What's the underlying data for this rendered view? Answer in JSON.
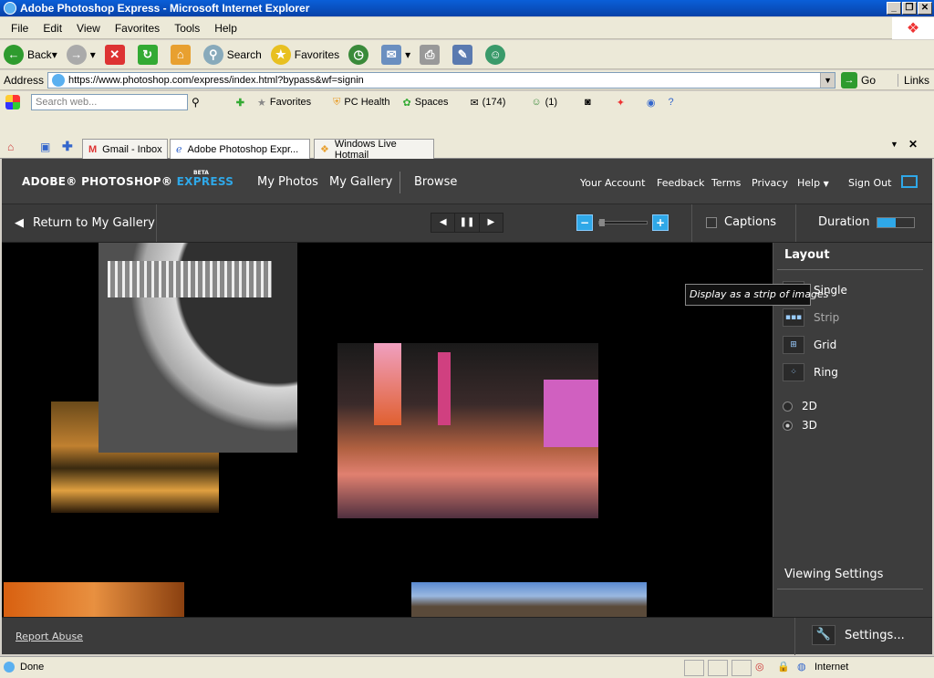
{
  "window": {
    "title": "Adobe Photoshop Express - Microsoft Internet Explorer"
  },
  "menu": [
    "File",
    "Edit",
    "View",
    "Favorites",
    "Tools",
    "Help"
  ],
  "toolbar": {
    "back": "Back",
    "search": "Search",
    "favorites": "Favorites"
  },
  "address": {
    "label": "Address",
    "url": "https://www.photoshop.com/express/index.html?bypass&wf=signin",
    "go": "Go",
    "links": "Links"
  },
  "searchbar": {
    "placeholder": "Search web...",
    "favorites": "Favorites",
    "pc_health": "PC Health",
    "spaces": "Spaces",
    "mail_count": "(174)",
    "contacts_count": "(1)"
  },
  "tabs": [
    {
      "label": "Gmail - Inbox"
    },
    {
      "label": "Adobe Photoshop Expr..."
    },
    {
      "label": "Windows Live Hotmail"
    }
  ],
  "app": {
    "logo_adobe": "ADOBE® PHOTOSHOP®",
    "logo_express": "EXPRESS",
    "logo_beta": "BETA",
    "nav": [
      "My Photos",
      "My Gallery",
      "Browse"
    ],
    "right_nav": [
      "Your Account",
      "Feedback",
      "Terms",
      "Privacy",
      "Help",
      "Sign Out"
    ],
    "return": "Return to My Gallery",
    "captions": "Captions",
    "duration": "Duration",
    "layout_title": "Layout",
    "layouts": [
      "Single",
      "Strip",
      "Grid",
      "Ring"
    ],
    "modes": [
      "2D",
      "3D"
    ],
    "selected_mode": "3D",
    "tooltip": "Display as a strip of images",
    "viewing_settings": "Viewing Settings",
    "report_abuse": "Report Abuse",
    "settings": "Settings..."
  },
  "status": {
    "text": "Done",
    "zone": "Internet"
  }
}
